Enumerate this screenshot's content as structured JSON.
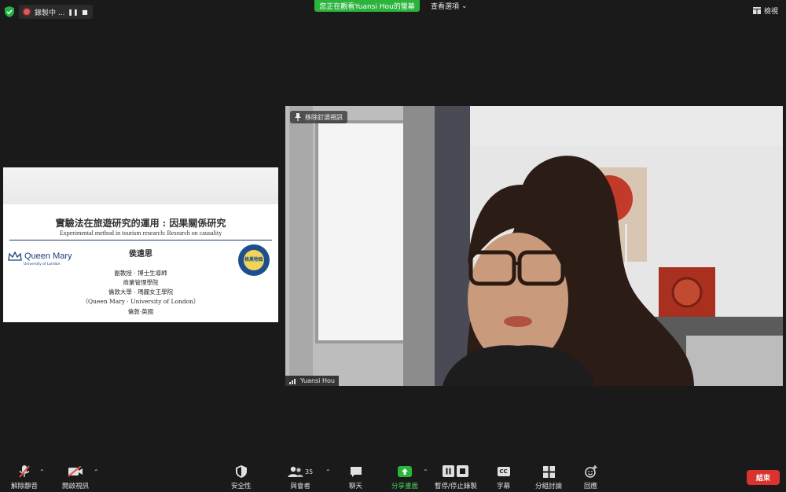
{
  "top": {
    "recording_label": "錄製中 ...",
    "viewing_banner": "您正在觀看Yuansi Hou的螢幕",
    "view_options": "查看選項",
    "view_button": "檢視"
  },
  "slide": {
    "title": "實驗法在旅遊研究的運用 : 因果關係研究",
    "subtitle": "Experimental method in tourism research: Research on causality",
    "presenter": "侯遠思",
    "lines": [
      "副教授 · 博士生導師",
      "商業管理學院",
      "倫敦大學 · 瑪麗女王學院",
      "（Queen Mary · University of London）",
      "倫敦·英國"
    ],
    "logo_name": "Queen Mary",
    "logo_sub": "University of London",
    "seal_text": "格莫物致"
  },
  "video": {
    "pin_label": "移除釘選視訊",
    "participant_name": "Yuansi Hou"
  },
  "toolbar": {
    "unmute": "解除靜音",
    "start_video": "開啟視訊",
    "security": "安全性",
    "participants": "與會者",
    "participants_count": "35",
    "chat": "聊天",
    "share_screen": "分享畫面",
    "pause_stop_recording": "暫停/停止錄製",
    "captions": "字幕",
    "breakout_rooms": "分組討論",
    "reactions": "回應",
    "end": "結束",
    "cc_glyph": "CC"
  },
  "colors": {
    "accent_green": "#2bb43c",
    "end_red": "#d8342f",
    "slide_navy": "#1a3d7a"
  }
}
